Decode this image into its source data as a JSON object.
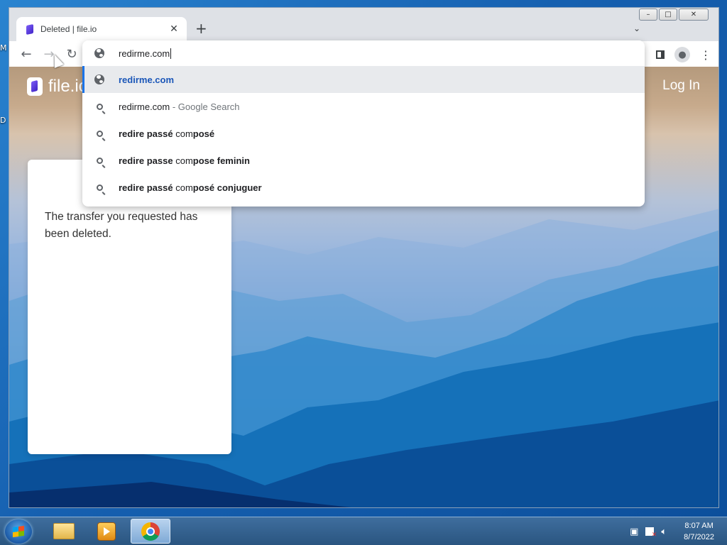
{
  "desktop": {
    "icon_label_top": "M",
    "icon_label_mid": "D"
  },
  "browser": {
    "tab": {
      "title": "Deleted | file.io",
      "close_glyph": "✕"
    },
    "new_tab_glyph": "+",
    "tab_search_glyph": "⌄",
    "window_controls": {
      "minimize": "–",
      "maximize": "□",
      "close": "✕"
    },
    "nav": {
      "back": "←",
      "forward": "→",
      "reload": "↻"
    },
    "menu_glyph": "⋮",
    "profile_glyph": "●"
  },
  "page": {
    "logo_text": "file.io",
    "login_label": "Log In",
    "card_message": "The transfer you requested has been deleted."
  },
  "omnibox": {
    "input_value": "redirme.com",
    "suggestions": [
      {
        "type": "url",
        "text": "redirme.com",
        "selected": true
      },
      {
        "type": "search",
        "text": "redirme.com",
        "suffix": " - Google Search"
      },
      {
        "type": "search",
        "prefix_bold": "redire passé ",
        "mid": "com",
        "bold_tail": "posé"
      },
      {
        "type": "search",
        "prefix_bold": "redire passe ",
        "mid": "com",
        "bold_tail": "pose feminin"
      },
      {
        "type": "search",
        "prefix_bold": "redire passé ",
        "mid": "com",
        "bold_tail": "posé conjuguer"
      }
    ]
  },
  "taskbar": {
    "clock_time": "8:07 AM",
    "clock_date": "8/7/2022",
    "apps": [
      "explorer",
      "media-player",
      "chrome"
    ]
  }
}
